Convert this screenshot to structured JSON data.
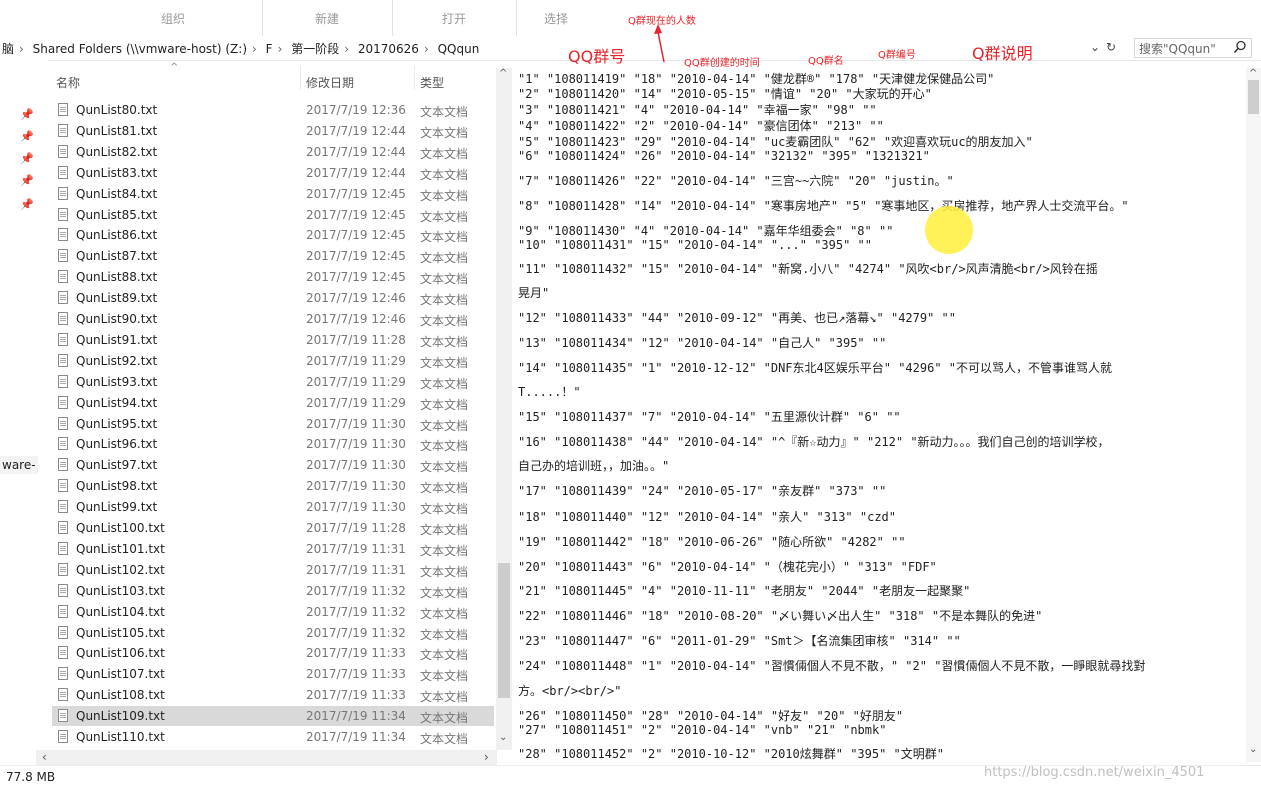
{
  "ribbon": {
    "organize": "组织",
    "new": "新建",
    "open": "打开",
    "select": "选择"
  },
  "address": {
    "crumbs": [
      "脑",
      "Shared Folders (\\\\vmware-host) (Z:)",
      "F",
      "第一阶段",
      "20170626",
      "QQqun"
    ],
    "refresh_symbol": "↻"
  },
  "search": {
    "placeholder": "搜索\"QQqun\""
  },
  "columns": {
    "name": "名称",
    "date": "修改日期",
    "type": "类型"
  },
  "nav": {
    "ware_label": "ware-"
  },
  "files": [
    {
      "name": "QunList80.txt",
      "date": "2017/7/19 12:36",
      "type": "文本文档"
    },
    {
      "name": "QunList81.txt",
      "date": "2017/7/19 12:44",
      "type": "文本文档"
    },
    {
      "name": "QunList82.txt",
      "date": "2017/7/19 12:44",
      "type": "文本文档"
    },
    {
      "name": "QunList83.txt",
      "date": "2017/7/19 12:44",
      "type": "文本文档"
    },
    {
      "name": "QunList84.txt",
      "date": "2017/7/19 12:45",
      "type": "文本文档"
    },
    {
      "name": "QunList85.txt",
      "date": "2017/7/19 12:45",
      "type": "文本文档"
    },
    {
      "name": "QunList86.txt",
      "date": "2017/7/19 12:45",
      "type": "文本文档"
    },
    {
      "name": "QunList87.txt",
      "date": "2017/7/19 12:45",
      "type": "文本文档"
    },
    {
      "name": "QunList88.txt",
      "date": "2017/7/19 12:45",
      "type": "文本文档"
    },
    {
      "name": "QunList89.txt",
      "date": "2017/7/19 12:46",
      "type": "文本文档"
    },
    {
      "name": "QunList90.txt",
      "date": "2017/7/19 12:46",
      "type": "文本文档"
    },
    {
      "name": "QunList91.txt",
      "date": "2017/7/19 11:28",
      "type": "文本文档"
    },
    {
      "name": "QunList92.txt",
      "date": "2017/7/19 11:29",
      "type": "文本文档"
    },
    {
      "name": "QunList93.txt",
      "date": "2017/7/19 11:29",
      "type": "文本文档"
    },
    {
      "name": "QunList94.txt",
      "date": "2017/7/19 11:29",
      "type": "文本文档"
    },
    {
      "name": "QunList95.txt",
      "date": "2017/7/19 11:30",
      "type": "文本文档"
    },
    {
      "name": "QunList96.txt",
      "date": "2017/7/19 11:30",
      "type": "文本文档"
    },
    {
      "name": "QunList97.txt",
      "date": "2017/7/19 11:30",
      "type": "文本文档"
    },
    {
      "name": "QunList98.txt",
      "date": "2017/7/19 11:30",
      "type": "文本文档"
    },
    {
      "name": "QunList99.txt",
      "date": "2017/7/19 11:30",
      "type": "文本文档"
    },
    {
      "name": "QunList100.txt",
      "date": "2017/7/19 11:28",
      "type": "文本文档"
    },
    {
      "name": "QunList101.txt",
      "date": "2017/7/19 11:31",
      "type": "文本文档"
    },
    {
      "name": "QunList102.txt",
      "date": "2017/7/19 11:31",
      "type": "文本文档"
    },
    {
      "name": "QunList103.txt",
      "date": "2017/7/19 11:32",
      "type": "文本文档"
    },
    {
      "name": "QunList104.txt",
      "date": "2017/7/19 11:32",
      "type": "文本文档"
    },
    {
      "name": "QunList105.txt",
      "date": "2017/7/19 11:32",
      "type": "文本文档"
    },
    {
      "name": "QunList106.txt",
      "date": "2017/7/19 11:33",
      "type": "文本文档"
    },
    {
      "name": "QunList107.txt",
      "date": "2017/7/19 11:33",
      "type": "文本文档"
    },
    {
      "name": "QunList108.txt",
      "date": "2017/7/19 11:33",
      "type": "文本文档"
    },
    {
      "name": "QunList109.txt",
      "date": "2017/7/19 11:34",
      "type": "文本文档",
      "selected": true
    },
    {
      "name": "QunList110.txt",
      "date": "2017/7/19 11:34",
      "type": "文本文档"
    }
  ],
  "status": {
    "size": "77.8 MB"
  },
  "watermark": "https://blog.csdn.net/weixin_4501",
  "annotations": {
    "members": "Q群现在的人数",
    "qq_number": "QQ群号",
    "created": "QQ群创建的时间",
    "group_name": "QQ群名",
    "group_id": "Q群编号",
    "description": "Q群说明"
  },
  "preview_lines": [
    "\"1\"    \"108011419\"  \"18\"   \"2010-04-14\"  \"健龙群®\"      \"178\"  \"天津健龙保健品公司\"",
    "\"2\"    \"108011420\"  \"14\"   \"2010-05-15\"  \"情谊\"  \"20\"    \"大家玩的开心\"",
    "\"3\"    \"108011421\"  \"4\"    \"2010-04-14\"  \"幸福一家\"      \"98\"   \"\"",
    "\"4\"    \"108011422\"  \"2\"    \"2010-04-14\"  \"豪信团体\"      \"213\"  \"\"",
    "\"5\"    \"108011423\"  \"29\"   \"2010-04-14\"  \"uc麦霸团队\"  \"62\"   \"欢迎喜欢玩uc的朋友加入\"",
    "\"6\"    \"108011424\"  \"26\"   \"2010-04-14\"  \"32132\"         \"395\"  \"1321321\"",
    "\"7\"    \"108011426\"  \"22\"   \"2010-04-14\"  \"三宫~~六院\"  \"20\"   \"justin。\"",
    "\"8\"    \"108011428\"  \"14\"   \"2010-04-14\"        \"寒事房地产\"  \"5\"      \"寒事地区，买房推荐，地产界人士交流平台。\"",
    "\"9\"    \"108011430\"  \"4\"    \"2010-04-14\"        \"嘉年华组委会\" \"8\"    \"\"",
    "\"10\"   \"108011431\"  \"15\"   \"2010-04-14\"        \"...\"  \"395\"  \"\"",
    "\"11\"   \"108011432\"  \"15\"   \"2010-04-14\"        \"新窝.小八\"     \"4274\"     \"风吹<br/>风声清脆<br/>风铃在摇",
    "晃月\"",
    "\"12\"   \"108011433\"  \"44\"   \"2010-09-12\"        \"再美、也已↗落幕↘\"  \"4279\"       \"\"",
    "\"13\"   \"108011434\"  \"12\"   \"2010-04-14\"        \"自己人\"     \"395\"  \"\"",
    "\"14\"   \"108011435\"  \"1\"    \"2010-12-12\"        \"DNF东北4区娱乐平台\" \"4296\"      \"不可以骂人，不管事谁骂人就",
    "T.....！\"",
    "\"15\"   \"108011437\"  \"7\"    \"2010-04-14\"        \"五里源伙计群\" \"6\"    \"\"",
    "\"16\"   \"108011438\"  \"44\"   \"2010-04-14\"        \"^『新☆动力』\"      \"212\"  \"新动力。。。我们自己创的培训学校，",
    "自己办的培训班，，加油。。\"",
    "\"17\"   \"108011439\"  \"24\"   \"2010-05-17\"        \"亲友群\"       \"373\"  \"\"",
    "\"18\"   \"108011440\"  \"12\"   \"2010-04-14\"        \"亲人\"  \"313\"  \"czd\"",
    "\"19\"   \"108011442\"  \"18\"   \"2010-06-26\"        \"随心所欲\"      \"4282\"       \"\"",
    "\"20\"   \"108011443\"  \"6\"    \"2010-04-14\"        \"（槐花完小）\"  \"313\"  \"FDF\"",
    "\"21\"   \"108011445\"  \"4\"    \"2010-11-11\"        \"老朋友\"       \"2044\"       \"老朋友一起聚聚\"",
    "\"22\"   \"108011446\"  \"18\"   \"2010-08-20\"        \"〆い舞い〆出人生\"    \"318\"  \"不是本舞队的免进\"",
    "\"23\"   \"108011447\"  \"6\"    \"2011-01-29\"        \"Smt＞【名流集团审核\"      \"314\"  \"\"",
    "\"24\"   \"108011448\"  \"1\"    \"2010-04-14\"        \"習慣倆個人不見不散，\"  \"2\"      \"習慣倆個人不見不散，一睜眼就尋找對",
    "方。<br/><br/>\"",
    "\"26\"   \"108011450\"  \"28\"   \"2010-04-14\"        \"好友\"  \"20\"   \"好朋友\"",
    "\"27\"   \"108011451\"  \"2\"    \"2010-04-14\"        \"vnb\"   \"21\"   \"nbmk\"",
    "\"28\"   \"108011452\"  \"2\"    \"2010-10-12\"        \"2010炫舞群\"  \"395\"  \"文明群\""
  ]
}
